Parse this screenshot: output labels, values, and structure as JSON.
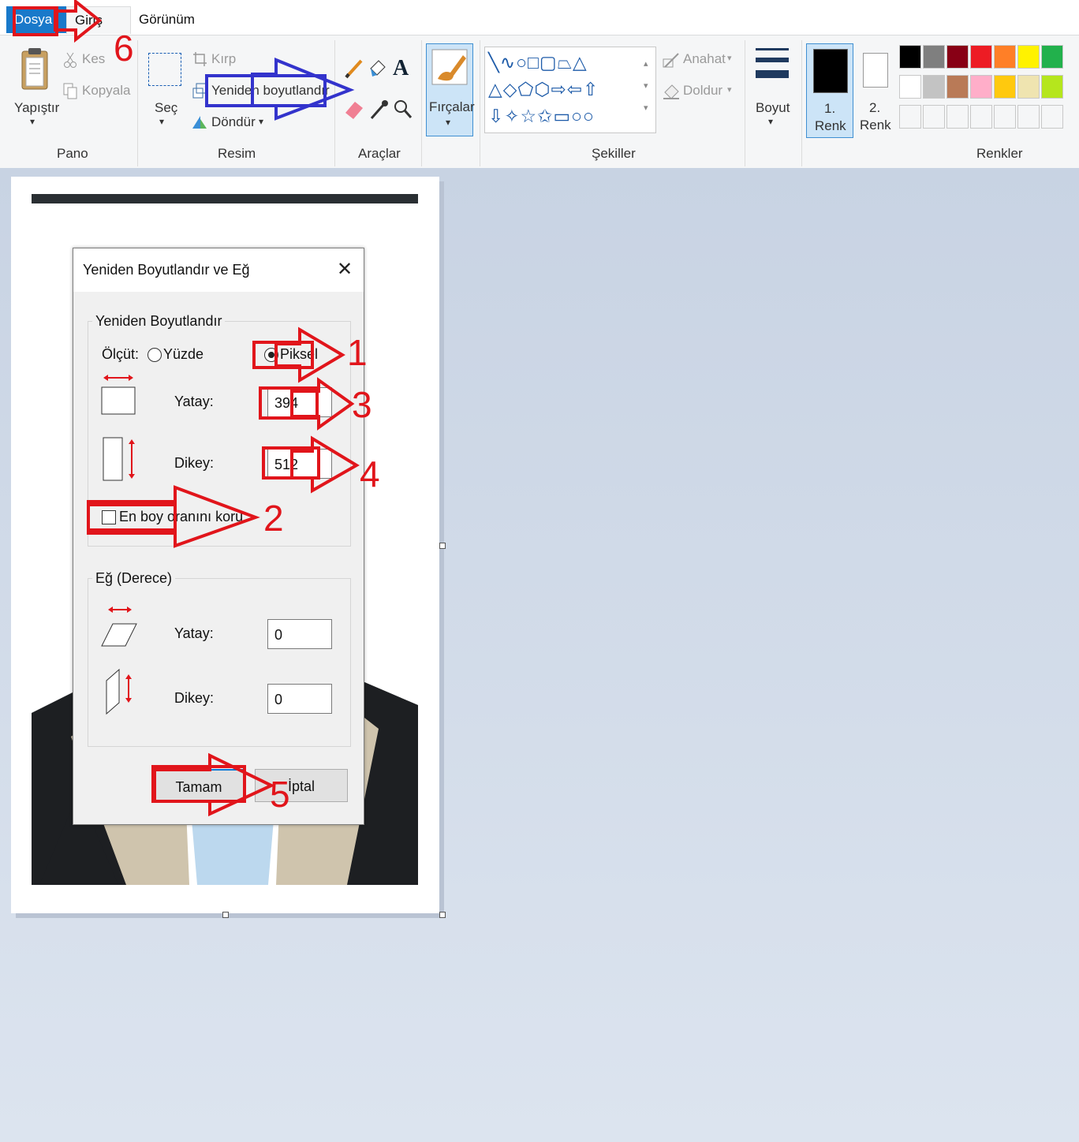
{
  "tabs": {
    "file": "Dosya",
    "home": "Giriş",
    "view": "Görünüm"
  },
  "ribbon": {
    "clipboard": {
      "paste": "Yapıştır",
      "cut": "Kes",
      "copy": "Kopyala",
      "label": "Pano"
    },
    "image": {
      "select": "Seç",
      "crop": "Kırp",
      "resize": "Yeniden boyutlandır",
      "rotate": "Döndür",
      "label": "Resim"
    },
    "tools": {
      "label": "Araçlar"
    },
    "brushes": {
      "label": "Fırçalar"
    },
    "shapes": {
      "outline": "Anahat",
      "fill": "Doldur",
      "label": "Şekiller"
    },
    "size": {
      "label": "Boyut"
    },
    "colors": {
      "color1_num": "1.",
      "color1_label": "Renk",
      "color2_num": "2.",
      "color2_label": "Renk",
      "label": "Renkler",
      "palette_row1": [
        "#000000",
        "#7f7f7f",
        "#880015",
        "#ed1c24",
        "#ff7f27",
        "#fff200",
        "#22b14c"
      ],
      "palette_row2": [
        "#ffffff",
        "#c3c3c3",
        "#b97a57",
        "#ffaec9",
        "#ffc90e",
        "#efe4b0",
        "#b5e61d"
      ]
    }
  },
  "dialog": {
    "title": "Yeniden Boyutlandır ve Eğ",
    "resize_group": "Yeniden Boyutlandır",
    "by_label": "Ölçüt:",
    "percent": "Yüzde",
    "pixels": "Piksel",
    "horizontal_label": "Yatay:",
    "horizontal_value": "394",
    "vertical_label": "Dikey:",
    "vertical_value": "512",
    "keep_ratio": "En boy oranını koru",
    "skew_group": "Eğ (Derece)",
    "skew_h_label": "Yatay:",
    "skew_h_value": "0",
    "skew_v_label": "Dikey:",
    "skew_v_value": "0",
    "ok": "Tamam",
    "cancel": "İptal"
  },
  "annotations": {
    "n1": "1",
    "n2": "2",
    "n3": "3",
    "n4": "4",
    "n5": "5",
    "n6": "6"
  }
}
